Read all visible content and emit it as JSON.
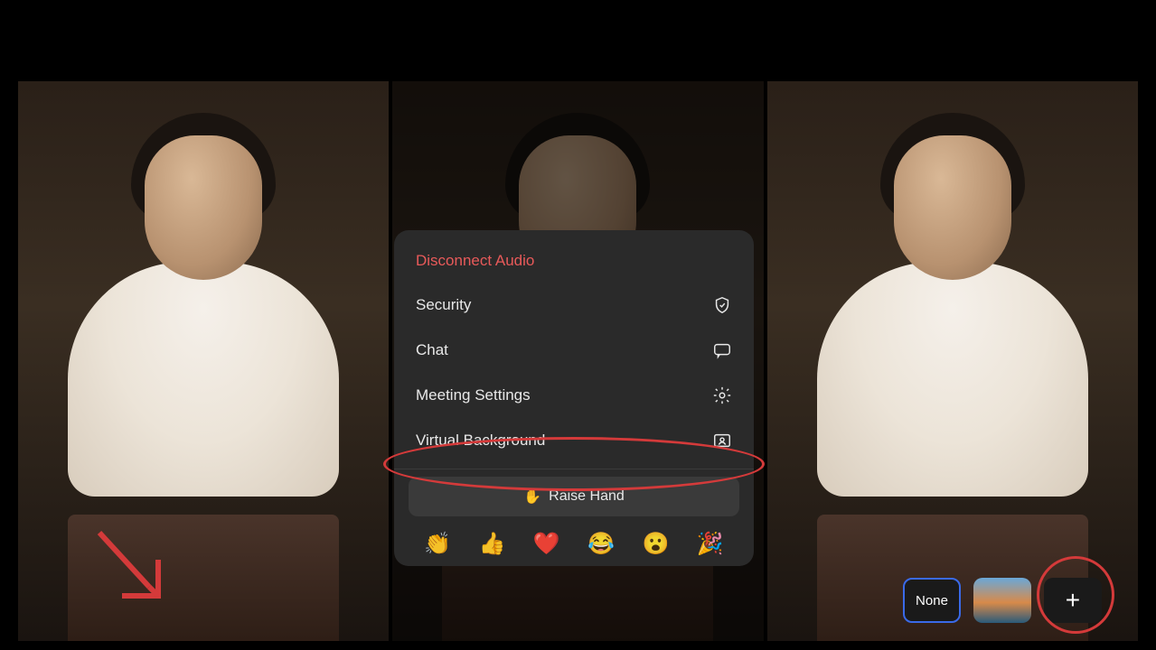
{
  "menu": {
    "header": "Disconnect Audio",
    "items": [
      {
        "label": "Security",
        "icon": "shield-icon"
      },
      {
        "label": "Chat",
        "icon": "chat-icon"
      },
      {
        "label": "Meeting Settings",
        "icon": "gear-icon"
      },
      {
        "label": "Virtual Background",
        "icon": "virtual-bg-icon"
      }
    ],
    "raise_hand_label": "Raise Hand",
    "reactions": [
      "👏",
      "👍",
      "❤️",
      "😂",
      "😮",
      "🎉"
    ]
  },
  "bg_options": {
    "none_label": "None",
    "add_label": "+"
  }
}
